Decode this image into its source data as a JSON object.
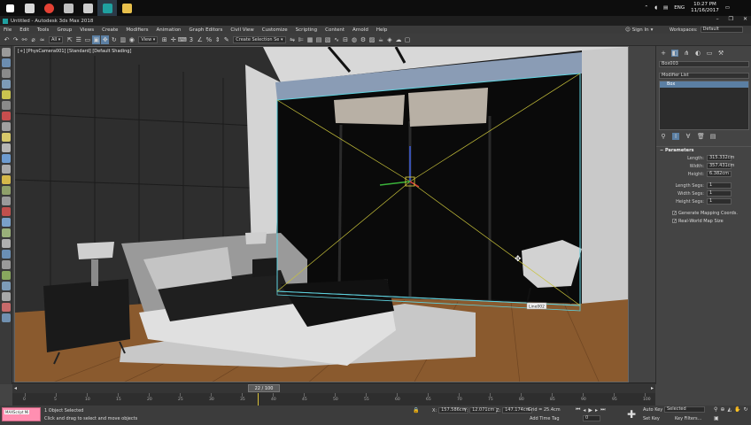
{
  "taskbar": {
    "apps": [
      {
        "name": "start",
        "color": "#ffffff"
      },
      {
        "name": "file-explorer",
        "color": "#d8d8d8"
      },
      {
        "name": "chrome",
        "color": "#e44134"
      },
      {
        "name": "app-3",
        "color": "#bfbfbf"
      },
      {
        "name": "photos",
        "color": "#cccccc"
      },
      {
        "name": "3dsmax",
        "color": "#1fa0a0"
      },
      {
        "name": "folder",
        "color": "#e8c04c"
      }
    ],
    "lang": "ENG",
    "time": "10:27 PM",
    "date": "11/16/2017"
  },
  "window": {
    "title": "Untitled - Autodesk 3ds Max 2018",
    "controls": [
      "–",
      "❐",
      "✕"
    ]
  },
  "menu": {
    "items": [
      "File",
      "Edit",
      "Tools",
      "Group",
      "Views",
      "Create",
      "Modifiers",
      "Animation",
      "Graph Editors",
      "Civil View",
      "Customize",
      "Scripting",
      "Content",
      "Arnold",
      "Help"
    ],
    "sign_in": "Sign In",
    "workspaces_label": "Workspaces:",
    "workspace": "Default"
  },
  "toolbar": {
    "filter": "All",
    "ref_coord": "View",
    "selection_set": "Create Selection Se"
  },
  "viewport": {
    "label": "[+] [PhysCamera001] [Standard] [Default Shading]",
    "object_tag": "Line002"
  },
  "command_panel": {
    "object_name": "Box003",
    "modifier_list": "Modifier List",
    "stack_item": "Box",
    "parameters_title": "Parameters",
    "params": [
      {
        "label": "Length:",
        "value": "315.332cm"
      },
      {
        "label": "Width:",
        "value": "357.431cm"
      },
      {
        "label": "Height:",
        "value": "6.382cm"
      },
      {
        "label": "Length Segs:",
        "value": "1"
      },
      {
        "label": "Width Segs:",
        "value": "1"
      },
      {
        "label": "Height Segs:",
        "value": "1"
      }
    ],
    "checks": [
      {
        "label": "Generate Mapping Coords.",
        "checked": true
      },
      {
        "label": "Real-World Map Size",
        "checked": true
      }
    ]
  },
  "timeline": {
    "thumb": "22 / 100",
    "ticks": [
      "0",
      "5",
      "10",
      "15",
      "20",
      "25",
      "30",
      "35",
      "40",
      "45",
      "50",
      "55",
      "60",
      "65",
      "70",
      "75",
      "80",
      "85",
      "90",
      "95",
      "100"
    ],
    "current": 22
  },
  "status": {
    "maxscript": "MAXScript Mi",
    "selection": "1 Object Selected",
    "prompt": "Click and drag to select and move objects",
    "x_label": "X:",
    "x": "157.586cm",
    "y_label": "Y:",
    "y": "12.071cm",
    "z_label": "Z:",
    "z": "147.174cm",
    "grid": "Grid = 25.4cm",
    "add_time_tag": "Add Time Tag",
    "frame": "0",
    "auto_key": "Auto Key",
    "set_key": "Set Key",
    "selected": "Selected",
    "key_filters": "Key Filters..."
  },
  "colors": {
    "accent": "#5b7fa3",
    "selection": "#5fd3e0",
    "maxscript": "#ff8fb1"
  }
}
